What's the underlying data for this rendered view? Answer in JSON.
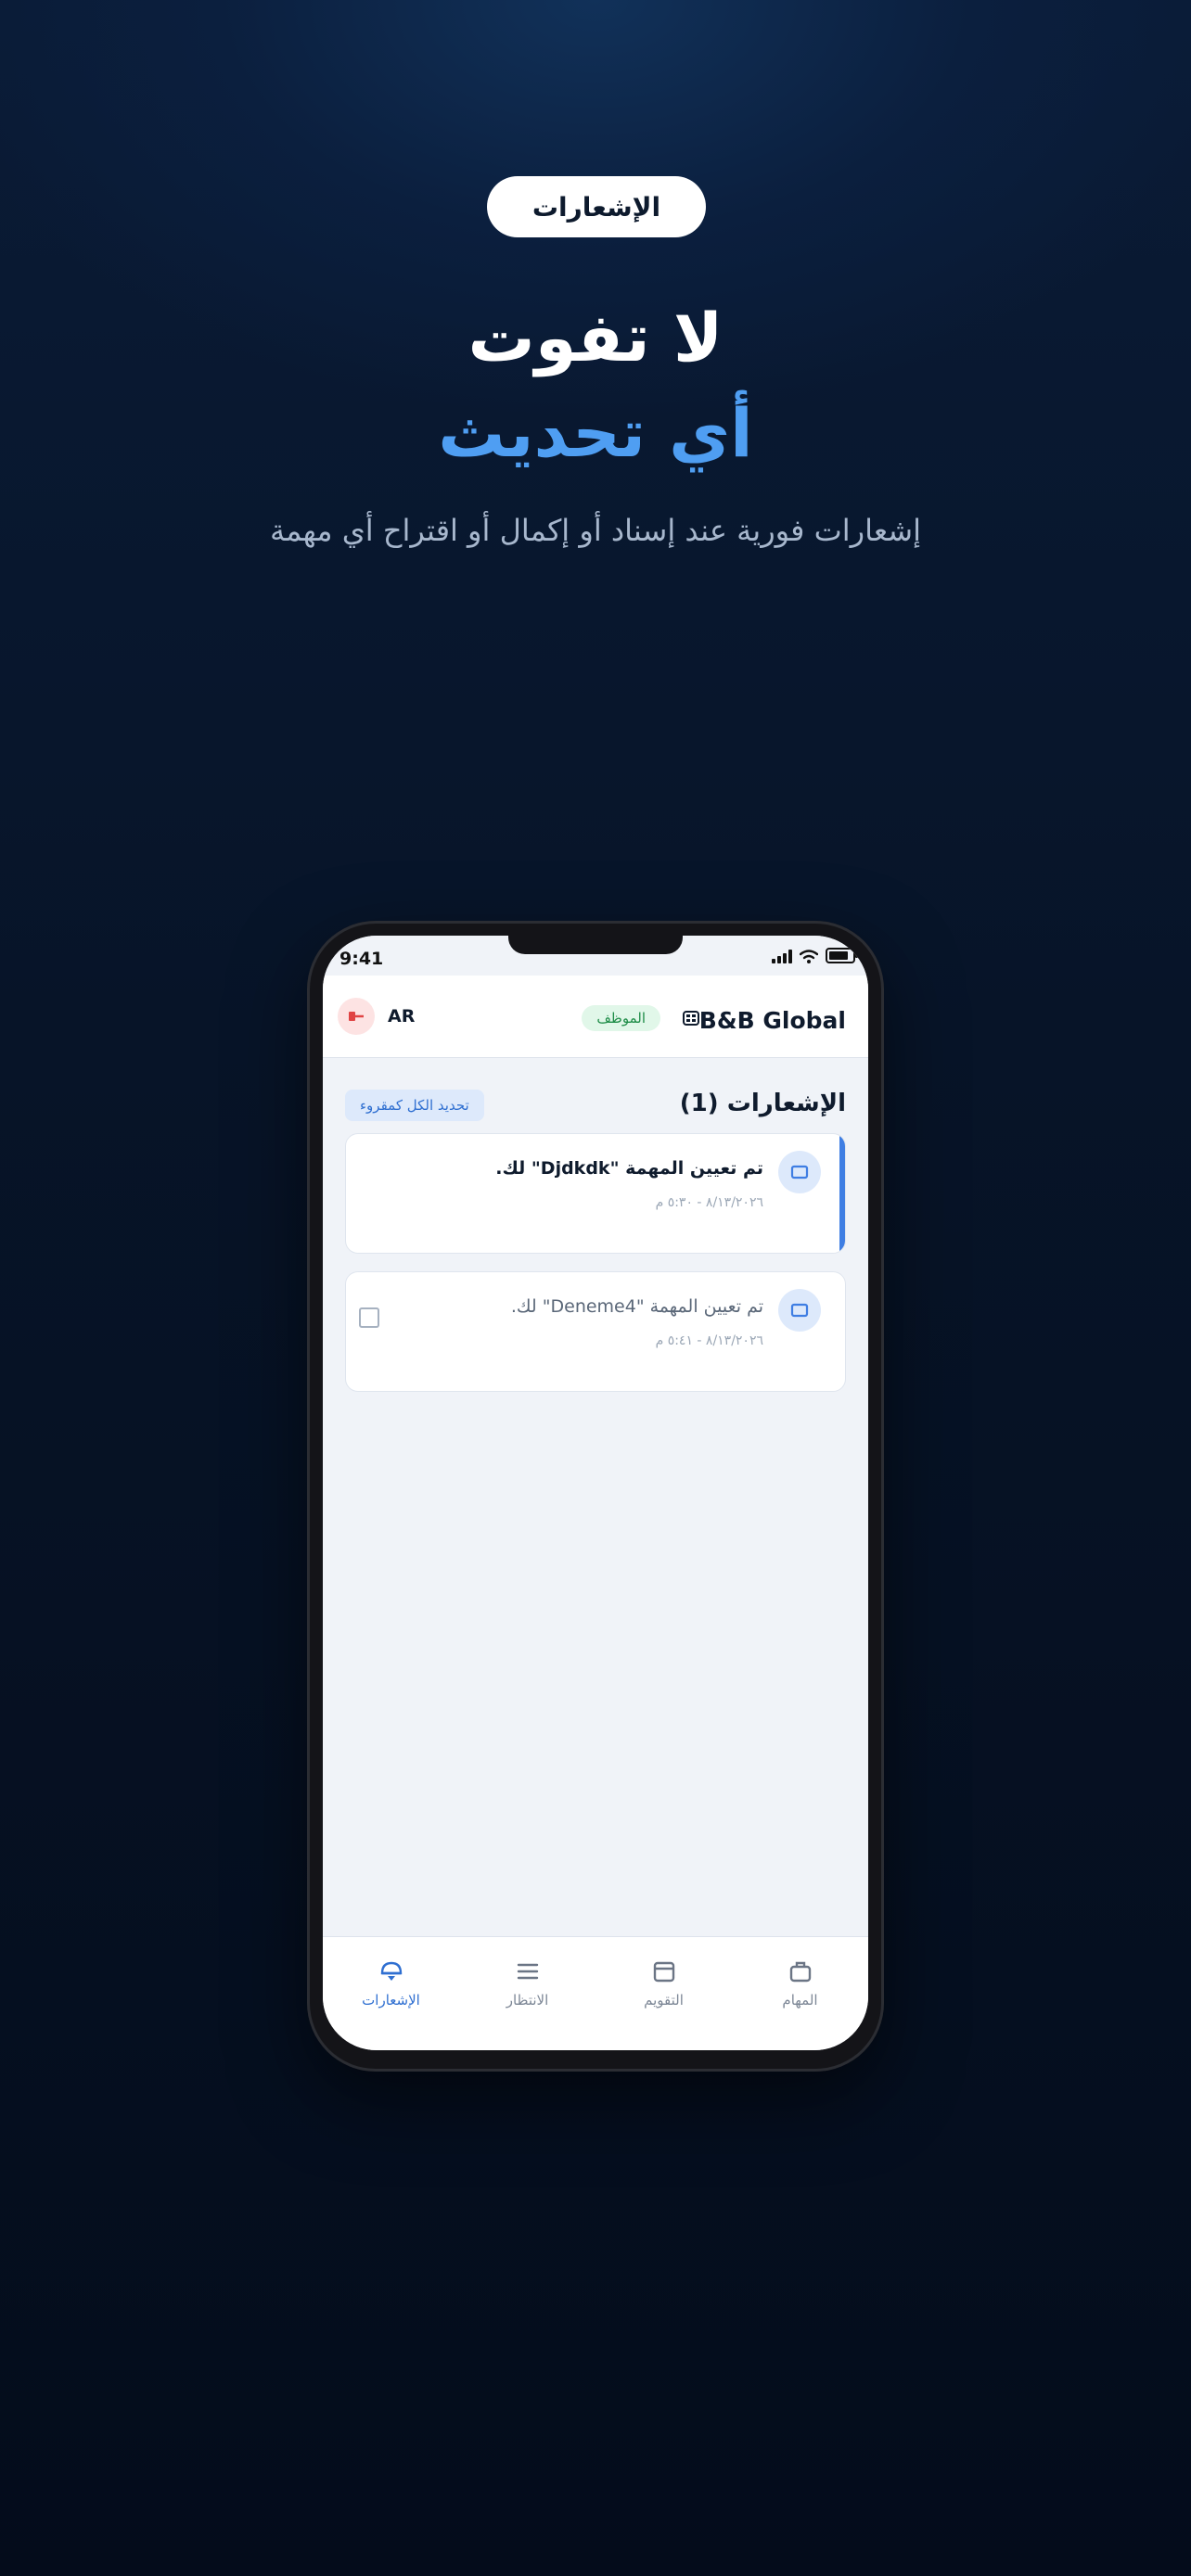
{
  "hero": {
    "pill_label": "الإشعارات",
    "headline_line1": "لا تفوت",
    "headline_line2": "أي تحديث",
    "subtitle": "إشعارات فورية عند إسناد أو إكمال أو اقتراح أي مهمة"
  },
  "status_bar": {
    "time": "9:41"
  },
  "app_bar": {
    "brand": "B&B Global",
    "role_badge": "الموظف",
    "language": "AR"
  },
  "notifications": {
    "title": "الإشعارات (1)",
    "mark_all_label": "تحديد الكل كمقروء",
    "items": [
      {
        "text": "تم تعيين المهمة \"Djdkdk\" لك.",
        "time": "٨/١٣/٢٠٢٦ - ٥:٣٠ م",
        "read": false
      },
      {
        "text": "تم تعيين المهمة \"Deneme4\" لك.",
        "time": "٨/١٣/٢٠٢٦ - ٥:٤١ م",
        "read": true
      }
    ]
  },
  "tab_bar": {
    "tabs": [
      {
        "label": "الإشعارات",
        "icon": "bell-icon",
        "active": true
      },
      {
        "label": "الانتظار",
        "icon": "menu-icon",
        "active": false
      },
      {
        "label": "التقويم",
        "icon": "calendar-icon",
        "active": false
      },
      {
        "label": "المهام",
        "icon": "briefcase-icon",
        "active": false
      }
    ]
  },
  "colors": {
    "accent": "#3f7ee3",
    "headline_accent": "#4f9ef2",
    "badge_green": "#1f8d48",
    "logout_red": "#e04444"
  }
}
